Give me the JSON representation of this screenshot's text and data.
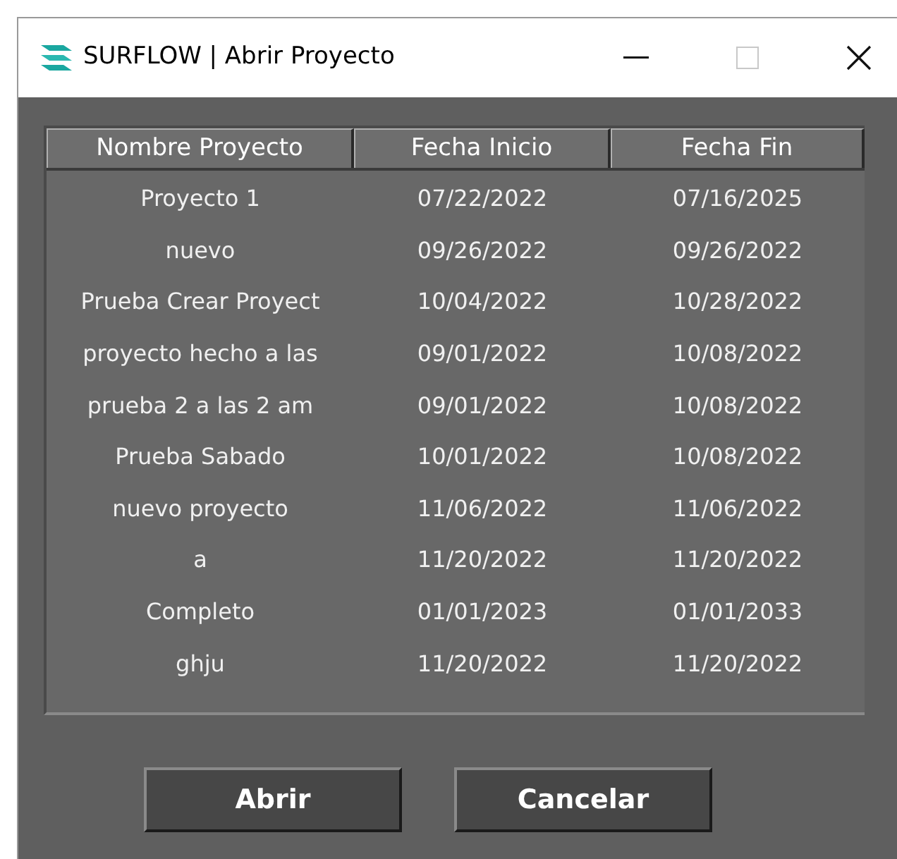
{
  "window": {
    "title": "SURFLOW | Abrir Proyecto"
  },
  "table": {
    "columns": [
      "Nombre Proyecto",
      "Fecha Inicio",
      "Fecha Fin"
    ],
    "rows": [
      {
        "cells": [
          "Proyecto 1",
          "07/22/2022",
          "07/16/2025"
        ]
      },
      {
        "cells": [
          "nuevo",
          "09/26/2022",
          "09/26/2022"
        ]
      },
      {
        "cells": [
          "Prueba Crear Proyect",
          "10/04/2022",
          "10/28/2022"
        ]
      },
      {
        "cells": [
          "proyecto hecho a las",
          "09/01/2022",
          "10/08/2022"
        ]
      },
      {
        "cells": [
          "prueba 2 a las 2 am",
          "09/01/2022",
          "10/08/2022"
        ]
      },
      {
        "cells": [
          "Prueba Sabado",
          "10/01/2022",
          "10/08/2022"
        ]
      },
      {
        "cells": [
          "nuevo proyecto",
          "11/06/2022",
          "11/06/2022"
        ]
      },
      {
        "cells": [
          "a",
          "11/20/2022",
          "11/20/2022"
        ]
      },
      {
        "cells": [
          "Completo",
          "01/01/2023",
          "01/01/2033"
        ]
      },
      {
        "cells": [
          "ghju",
          "11/20/2022",
          "11/20/2022"
        ]
      }
    ]
  },
  "buttons": [
    "Abrir",
    "Cancelar"
  ]
}
